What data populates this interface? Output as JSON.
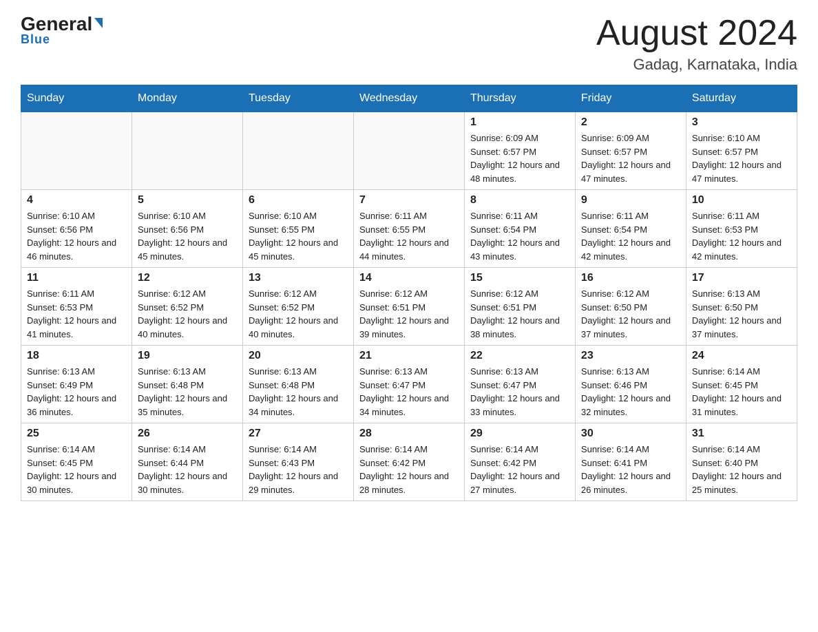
{
  "logo": {
    "name_part1": "General",
    "name_arrow": "▶",
    "name_part2": "Blue"
  },
  "title": {
    "month_year": "August 2024",
    "location": "Gadag, Karnataka, India"
  },
  "days_of_week": [
    "Sunday",
    "Monday",
    "Tuesday",
    "Wednesday",
    "Thursday",
    "Friday",
    "Saturday"
  ],
  "weeks": [
    {
      "days": [
        {
          "number": "",
          "info": "",
          "empty": true
        },
        {
          "number": "",
          "info": "",
          "empty": true
        },
        {
          "number": "",
          "info": "",
          "empty": true
        },
        {
          "number": "",
          "info": "",
          "empty": true
        },
        {
          "number": "1",
          "info": "Sunrise: 6:09 AM\nSunset: 6:57 PM\nDaylight: 12 hours and 48 minutes.",
          "empty": false
        },
        {
          "number": "2",
          "info": "Sunrise: 6:09 AM\nSunset: 6:57 PM\nDaylight: 12 hours and 47 minutes.",
          "empty": false
        },
        {
          "number": "3",
          "info": "Sunrise: 6:10 AM\nSunset: 6:57 PM\nDaylight: 12 hours and 47 minutes.",
          "empty": false
        }
      ]
    },
    {
      "days": [
        {
          "number": "4",
          "info": "Sunrise: 6:10 AM\nSunset: 6:56 PM\nDaylight: 12 hours and 46 minutes.",
          "empty": false
        },
        {
          "number": "5",
          "info": "Sunrise: 6:10 AM\nSunset: 6:56 PM\nDaylight: 12 hours and 45 minutes.",
          "empty": false
        },
        {
          "number": "6",
          "info": "Sunrise: 6:10 AM\nSunset: 6:55 PM\nDaylight: 12 hours and 45 minutes.",
          "empty": false
        },
        {
          "number": "7",
          "info": "Sunrise: 6:11 AM\nSunset: 6:55 PM\nDaylight: 12 hours and 44 minutes.",
          "empty": false
        },
        {
          "number": "8",
          "info": "Sunrise: 6:11 AM\nSunset: 6:54 PM\nDaylight: 12 hours and 43 minutes.",
          "empty": false
        },
        {
          "number": "9",
          "info": "Sunrise: 6:11 AM\nSunset: 6:54 PM\nDaylight: 12 hours and 42 minutes.",
          "empty": false
        },
        {
          "number": "10",
          "info": "Sunrise: 6:11 AM\nSunset: 6:53 PM\nDaylight: 12 hours and 42 minutes.",
          "empty": false
        }
      ]
    },
    {
      "days": [
        {
          "number": "11",
          "info": "Sunrise: 6:11 AM\nSunset: 6:53 PM\nDaylight: 12 hours and 41 minutes.",
          "empty": false
        },
        {
          "number": "12",
          "info": "Sunrise: 6:12 AM\nSunset: 6:52 PM\nDaylight: 12 hours and 40 minutes.",
          "empty": false
        },
        {
          "number": "13",
          "info": "Sunrise: 6:12 AM\nSunset: 6:52 PM\nDaylight: 12 hours and 40 minutes.",
          "empty": false
        },
        {
          "number": "14",
          "info": "Sunrise: 6:12 AM\nSunset: 6:51 PM\nDaylight: 12 hours and 39 minutes.",
          "empty": false
        },
        {
          "number": "15",
          "info": "Sunrise: 6:12 AM\nSunset: 6:51 PM\nDaylight: 12 hours and 38 minutes.",
          "empty": false
        },
        {
          "number": "16",
          "info": "Sunrise: 6:12 AM\nSunset: 6:50 PM\nDaylight: 12 hours and 37 minutes.",
          "empty": false
        },
        {
          "number": "17",
          "info": "Sunrise: 6:13 AM\nSunset: 6:50 PM\nDaylight: 12 hours and 37 minutes.",
          "empty": false
        }
      ]
    },
    {
      "days": [
        {
          "number": "18",
          "info": "Sunrise: 6:13 AM\nSunset: 6:49 PM\nDaylight: 12 hours and 36 minutes.",
          "empty": false
        },
        {
          "number": "19",
          "info": "Sunrise: 6:13 AM\nSunset: 6:48 PM\nDaylight: 12 hours and 35 minutes.",
          "empty": false
        },
        {
          "number": "20",
          "info": "Sunrise: 6:13 AM\nSunset: 6:48 PM\nDaylight: 12 hours and 34 minutes.",
          "empty": false
        },
        {
          "number": "21",
          "info": "Sunrise: 6:13 AM\nSunset: 6:47 PM\nDaylight: 12 hours and 34 minutes.",
          "empty": false
        },
        {
          "number": "22",
          "info": "Sunrise: 6:13 AM\nSunset: 6:47 PM\nDaylight: 12 hours and 33 minutes.",
          "empty": false
        },
        {
          "number": "23",
          "info": "Sunrise: 6:13 AM\nSunset: 6:46 PM\nDaylight: 12 hours and 32 minutes.",
          "empty": false
        },
        {
          "number": "24",
          "info": "Sunrise: 6:14 AM\nSunset: 6:45 PM\nDaylight: 12 hours and 31 minutes.",
          "empty": false
        }
      ]
    },
    {
      "days": [
        {
          "number": "25",
          "info": "Sunrise: 6:14 AM\nSunset: 6:45 PM\nDaylight: 12 hours and 30 minutes.",
          "empty": false
        },
        {
          "number": "26",
          "info": "Sunrise: 6:14 AM\nSunset: 6:44 PM\nDaylight: 12 hours and 30 minutes.",
          "empty": false
        },
        {
          "number": "27",
          "info": "Sunrise: 6:14 AM\nSunset: 6:43 PM\nDaylight: 12 hours and 29 minutes.",
          "empty": false
        },
        {
          "number": "28",
          "info": "Sunrise: 6:14 AM\nSunset: 6:42 PM\nDaylight: 12 hours and 28 minutes.",
          "empty": false
        },
        {
          "number": "29",
          "info": "Sunrise: 6:14 AM\nSunset: 6:42 PM\nDaylight: 12 hours and 27 minutes.",
          "empty": false
        },
        {
          "number": "30",
          "info": "Sunrise: 6:14 AM\nSunset: 6:41 PM\nDaylight: 12 hours and 26 minutes.",
          "empty": false
        },
        {
          "number": "31",
          "info": "Sunrise: 6:14 AM\nSunset: 6:40 PM\nDaylight: 12 hours and 25 minutes.",
          "empty": false
        }
      ]
    }
  ]
}
